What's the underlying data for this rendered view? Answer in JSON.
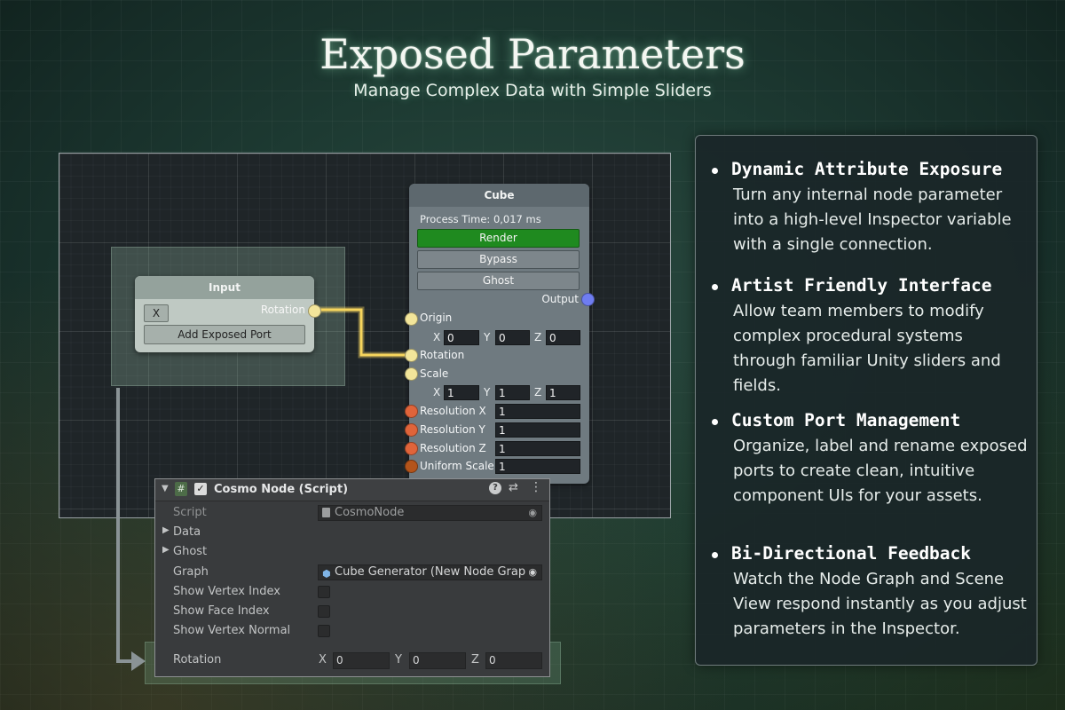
{
  "header": {
    "title": "Exposed Parameters",
    "subtitle": "Manage Complex Data with Simple Sliders"
  },
  "input_node": {
    "title": "Input",
    "x_button": "X",
    "output_port": "Rotation",
    "add_button": "Add Exposed Port"
  },
  "cube_node": {
    "title": "Cube",
    "process_time": "Process Time: 0,017 ms",
    "buttons": [
      "Render",
      "Bypass",
      "Ghost"
    ],
    "output_label": "Output",
    "origin_label": "Origin",
    "origin": {
      "x": "0",
      "y": "0",
      "z": "0"
    },
    "rotation_label": "Rotation",
    "scale_label": "Scale",
    "scale": {
      "x": "1",
      "y": "1",
      "z": "1"
    },
    "res_x_label": "Resolution X",
    "res_x": "1",
    "res_y_label": "Resolution Y",
    "res_y": "1",
    "res_z_label": "Resolution Z",
    "res_z": "1",
    "uniform_label": "Uniform Scale",
    "uniform": "1",
    "axis": {
      "x": "X",
      "y": "Y",
      "z": "Z"
    }
  },
  "inspector": {
    "component_title": "Cosmo Node (Script)",
    "script_label": "Script",
    "script_value": "CosmoNode",
    "data_label": "Data",
    "ghost_label": "Ghost",
    "graph_label": "Graph",
    "graph_value": "Cube Generator (New Node Grap",
    "vertex_index_label": "Show Vertex Index",
    "face_index_label": "Show Face Index",
    "vertex_normal_label": "Show Vertex Normal",
    "rotation_label": "Rotation",
    "rotation": {
      "x": "0",
      "y": "0",
      "z": "0"
    }
  },
  "features": [
    {
      "title": "Dynamic Attribute Exposure",
      "desc": "Turn any internal node parameter into a high-level Inspector variable with a single connection."
    },
    {
      "title": "Artist Friendly Interface",
      "desc": "Allow team members to modify complex procedural systems through familiar Unity sliders and fields."
    },
    {
      "title": "Custom Port Management",
      "desc": "Organize, label and rename exposed ports to create clean, intuitive component UIs for your assets."
    },
    {
      "title": "Bi-Directional Feedback",
      "desc": "Watch the Node Graph and Scene View respond instantly as you adjust parameters in the Inspector."
    }
  ],
  "colors": {
    "render_active": "#1f8a1f",
    "port_vector": "#f2e59a",
    "port_float": "#e0643a",
    "port_uniform": "#b4541a",
    "port_output": "#6f7df0",
    "wire": "#f2d25a"
  }
}
